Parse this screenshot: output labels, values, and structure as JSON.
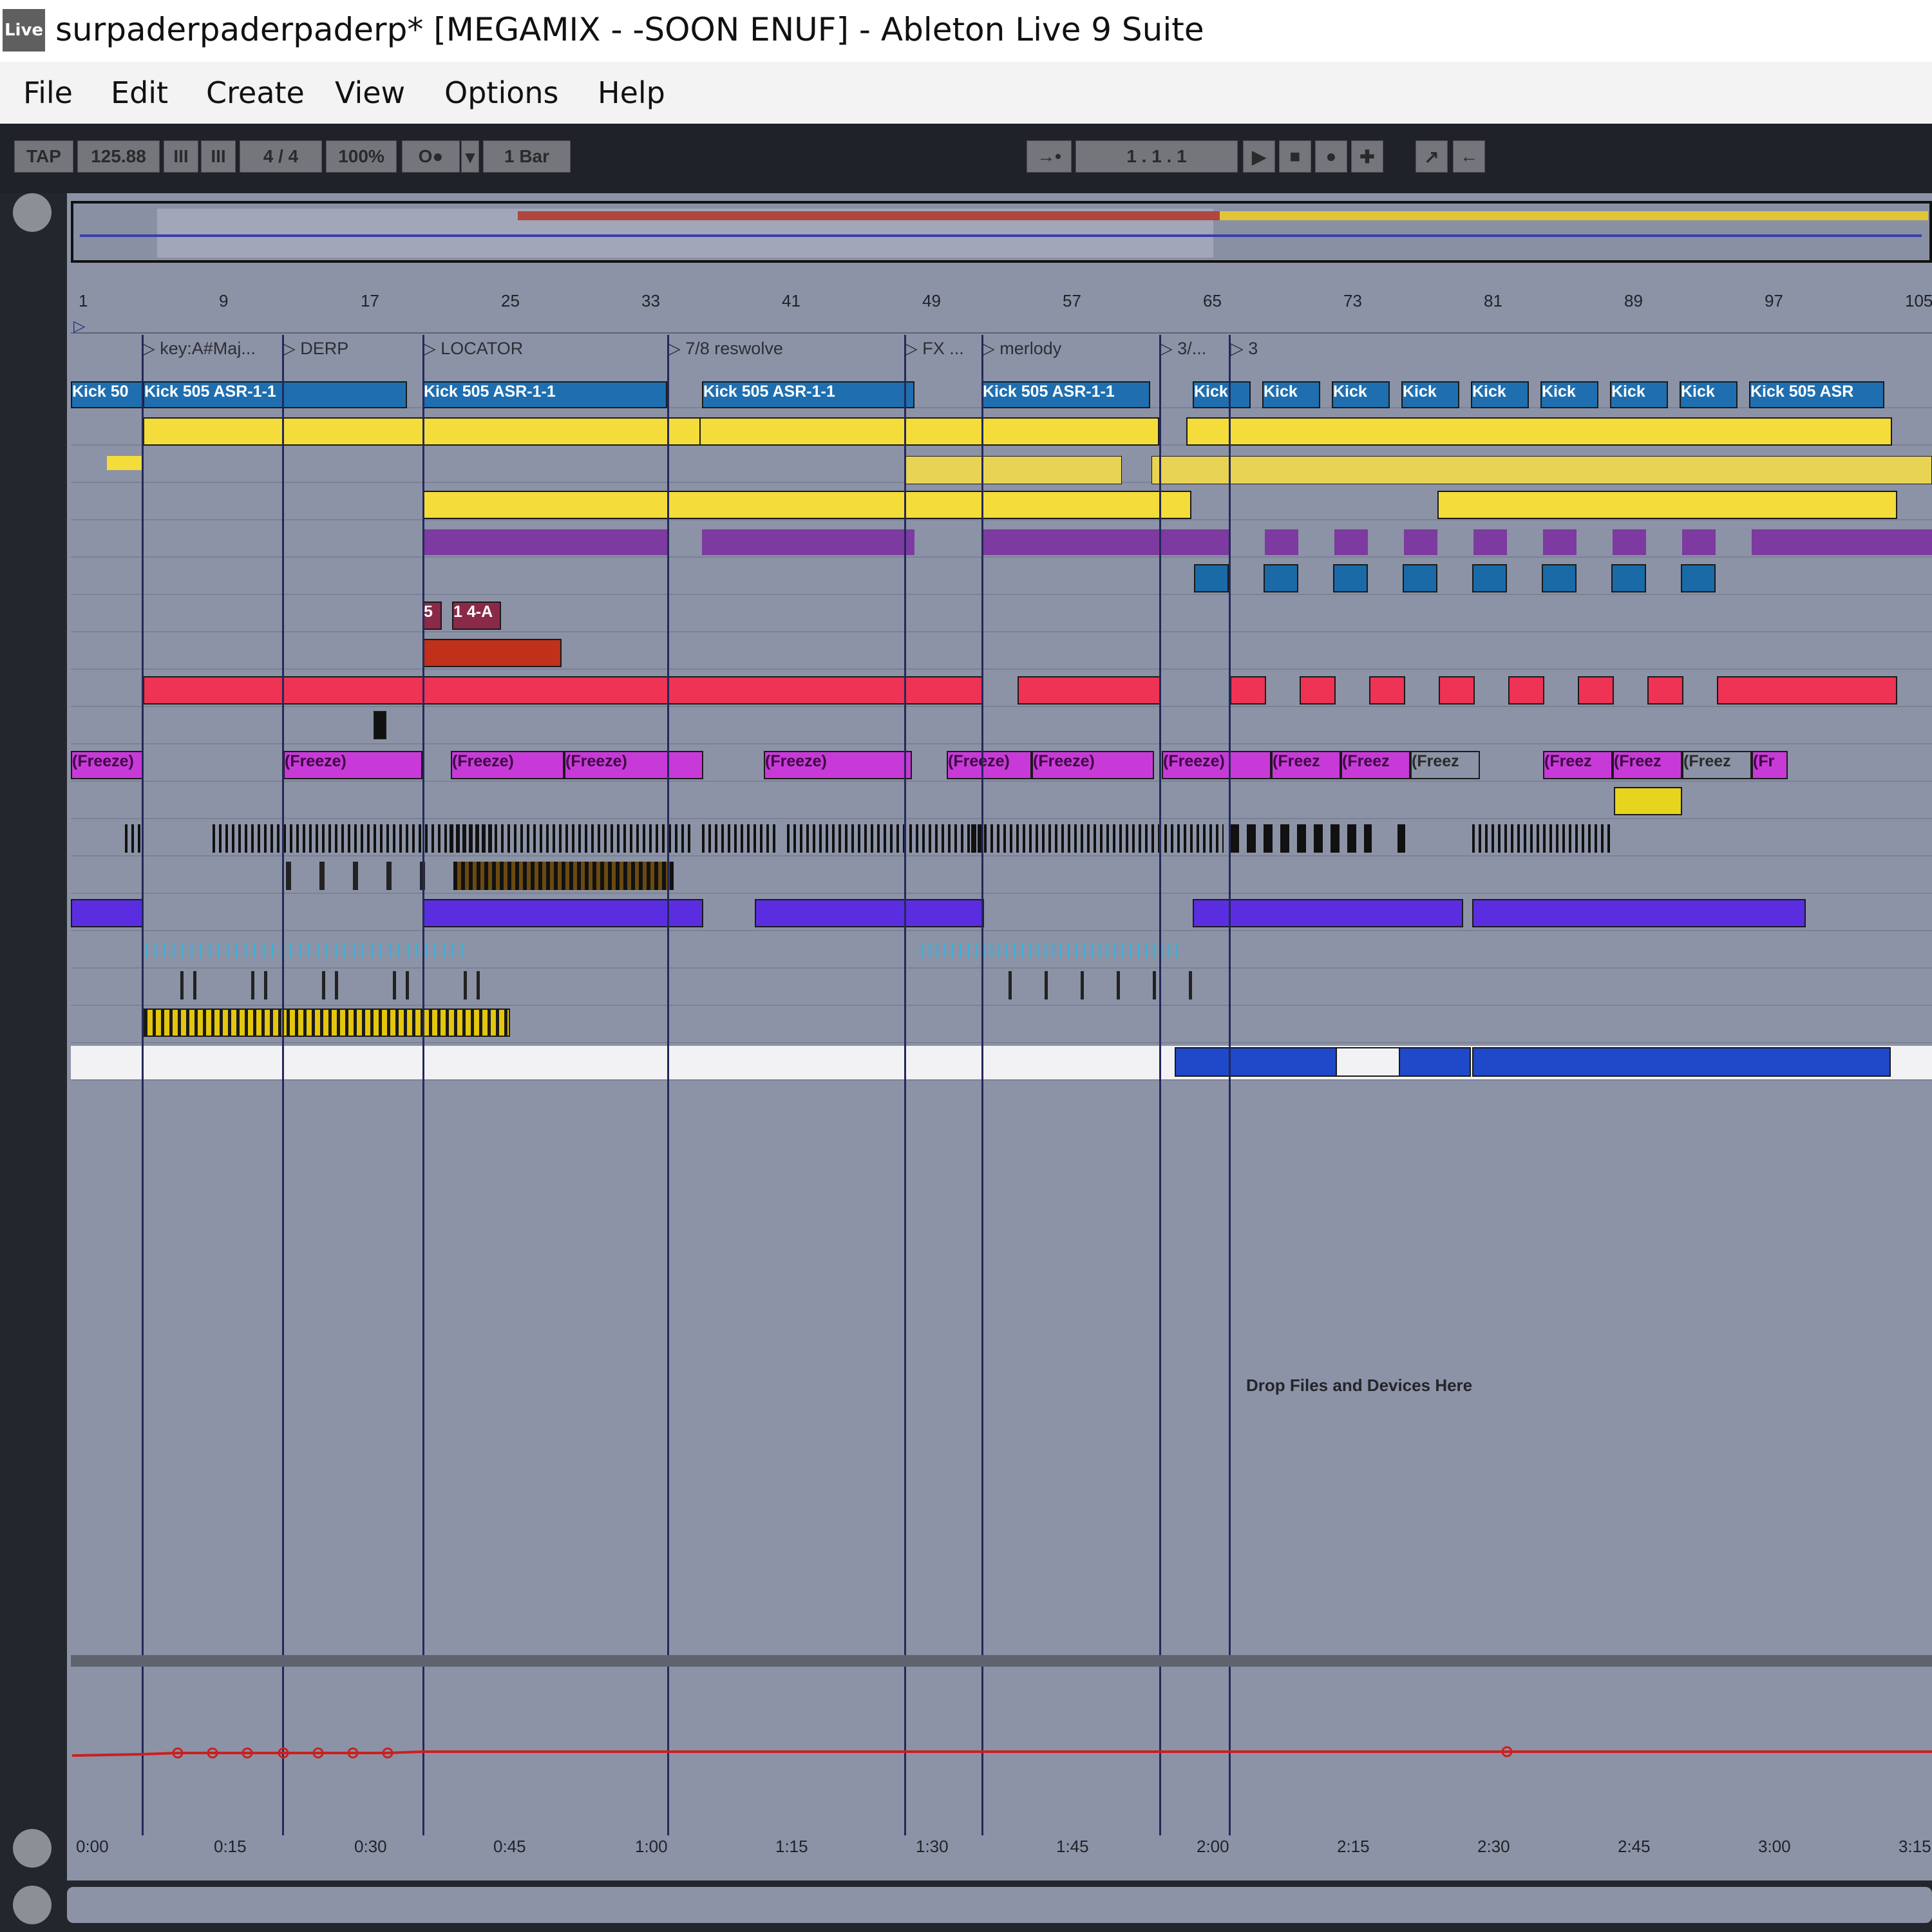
{
  "window": {
    "app_icon_label": "Live",
    "title": "surpaderpaderpaderp*  [MEGAMIX - -SOON ENUF] - Ableton Live 9 Suite"
  },
  "menu": [
    "File",
    "Edit",
    "Create",
    "View",
    "Options",
    "Help"
  ],
  "control_bar": {
    "tap": "TAP",
    "tempo": "125.88",
    "nudge_down": "III",
    "nudge_up": "III",
    "time_signature": "4  /  4",
    "groove_amount": "100%",
    "metronome": "O●",
    "quantization": "1 Bar",
    "follow": "→•",
    "position": "1 .   1 .   1",
    "play": "▶",
    "stop": "■",
    "record": "●",
    "add": "✚",
    "draw": "↗",
    "back_to_arrangement": "←"
  },
  "ruler": {
    "bars": [
      "1",
      "9",
      "17",
      "25",
      "33",
      "41",
      "49",
      "57",
      "65",
      "73",
      "81",
      "89",
      "97",
      "105"
    ]
  },
  "locators": [
    {
      "label": "key:A#Maj..."
    },
    {
      "label": "DERP"
    },
    {
      "label": "LOCATOR"
    },
    {
      "label": "7/8 reswolve"
    },
    {
      "label": "FX ..."
    },
    {
      "label": "merlody"
    },
    {
      "label": "3/..."
    },
    {
      "label": "3"
    }
  ],
  "clip_labels": {
    "kick_short": "Kick 50",
    "kick_full": "Kick 505 ASR-1-1",
    "kick_tiny": "Kick",
    "kick_last": "Kick 505 ASR",
    "freeze": "(Freeze)",
    "freeze_short": "(Freez",
    "freeze_tiny": "(Fr",
    "small_clip": "5",
    "small_clip_2": "1 4-A"
  },
  "drop_area": "Drop Files and Devices Here",
  "time_ruler": [
    "0:00",
    "0:15",
    "0:30",
    "0:45",
    "1:00",
    "1:15",
    "1:30",
    "1:45",
    "2:00",
    "2:15",
    "2:30",
    "2:45",
    "3:00",
    "3:15"
  ],
  "colors": {
    "kick": "#1f6fb0",
    "yellow": "#f4dc3a",
    "purple_mid": "#7d3aa0",
    "blue_small": "#1a6aa8",
    "red": "#ee3355",
    "magenta": "#c83ad8",
    "violet": "#5a2ee0",
    "blue_bottom": "#1f49c8",
    "automation": "#cc1f1f"
  }
}
